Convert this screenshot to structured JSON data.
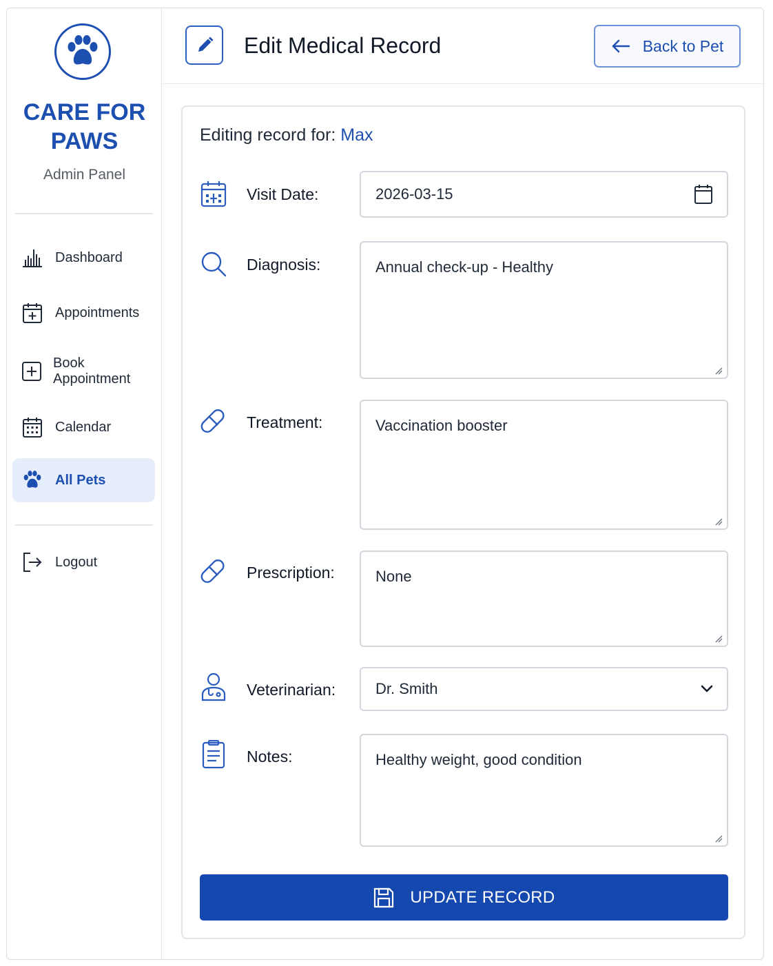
{
  "sidebar": {
    "brand_line1": "CARE FOR",
    "brand_line2": "PAWS",
    "subtitle": "Admin Panel",
    "logo_icon": "paw-icon",
    "items": [
      {
        "label": "Dashboard",
        "icon": "bar-chart-icon"
      },
      {
        "label": "Appointments",
        "icon": "calendar-plus-icon"
      },
      {
        "label": "Book Appointment",
        "icon": "plus-square-icon"
      },
      {
        "label": "Calendar",
        "icon": "calendar-grid-icon"
      },
      {
        "label": "All Pets",
        "icon": "paw-icon",
        "active": true
      }
    ],
    "logout": {
      "label": "Logout",
      "icon": "logout-icon"
    }
  },
  "header": {
    "title": "Edit Medical Record",
    "icon": "pencil-icon",
    "back_label": "Back to Pet",
    "back_icon": "arrow-left-icon"
  },
  "form": {
    "editing_prefix": "Editing record for:",
    "pet_name": "Max",
    "fields": {
      "visit_date": {
        "label": "Visit Date:",
        "value": "2026-03-15",
        "icon": "calendar-icon"
      },
      "diagnosis": {
        "label": "Diagnosis:",
        "value": "Annual check-up - Healthy",
        "icon": "search-icon"
      },
      "treatment": {
        "label": "Treatment:",
        "value": "Vaccination booster",
        "icon": "pill-icon"
      },
      "prescription": {
        "label": "Prescription:",
        "value": "None",
        "icon": "pill-icon"
      },
      "veterinarian": {
        "label": "Veterinarian:",
        "value": "Dr. Smith",
        "icon": "doctor-icon"
      },
      "notes": {
        "label": "Notes:",
        "value": "Healthy weight, good condition",
        "icon": "clipboard-icon"
      }
    },
    "submit_label": "UPDATE RECORD",
    "submit_icon": "save-icon"
  },
  "colors": {
    "accent": "#1d4fb0",
    "button": "#1448ae",
    "active_bg": "#e6eefb"
  }
}
